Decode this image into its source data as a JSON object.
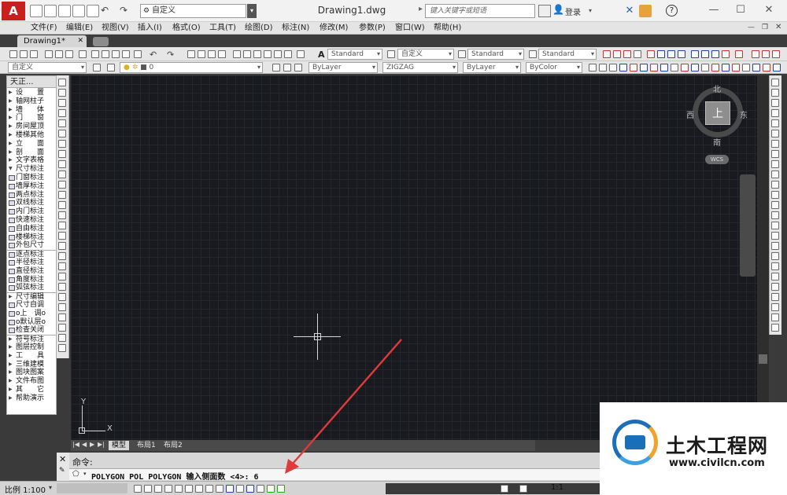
{
  "app": {
    "logo_letter": "A",
    "workspace": "自定义",
    "document_title": "Drawing1.dwg",
    "search_placeholder": "键入关键字或短语",
    "login_label": "登录",
    "help_symbol": "?"
  },
  "menu": {
    "items": [
      "文件(F)",
      "编辑(E)",
      "视图(V)",
      "插入(I)",
      "格式(O)",
      "工具(T)",
      "绘图(D)",
      "标注(N)",
      "修改(M)",
      "参数(P)",
      "窗口(W)",
      "帮助(H)"
    ]
  },
  "tabs": {
    "document_tab": "Drawing1*"
  },
  "toolbar": {
    "text_style": "Standard",
    "dim_style": "自定义",
    "table_style": "Standard",
    "multileader_style": "Standard",
    "workspace_combo": "自定义",
    "layer_value": "0",
    "color": "ByLayer",
    "linetype": "ZIGZAG",
    "lineweight": "ByLayer",
    "plotstyle": "ByColor"
  },
  "left_panel": {
    "title": "天正...",
    "items": [
      {
        "label": "设　　置",
        "kind": "menu"
      },
      {
        "label": "轴网柱子",
        "kind": "menu"
      },
      {
        "label": "墙　　体",
        "kind": "menu"
      },
      {
        "label": "门　　窗",
        "kind": "menu"
      },
      {
        "label": "房间屋顶",
        "kind": "menu"
      },
      {
        "label": "楼梯其他",
        "kind": "menu"
      },
      {
        "label": "立　　面",
        "kind": "menu"
      },
      {
        "label": "剖　　面",
        "kind": "menu"
      },
      {
        "label": "文字表格",
        "kind": "menu"
      },
      {
        "label": "尺寸标注",
        "kind": "open"
      },
      {
        "label": "门窗标注",
        "kind": "tool"
      },
      {
        "label": "墙厚标注",
        "kind": "tool"
      },
      {
        "label": "两点标注",
        "kind": "tool"
      },
      {
        "label": "双线标注",
        "kind": "tool"
      },
      {
        "label": "内门标注",
        "kind": "tool"
      },
      {
        "label": "快速标注",
        "kind": "tool"
      },
      {
        "label": "自由标注",
        "kind": "tool"
      },
      {
        "label": "楼梯标注",
        "kind": "tool"
      },
      {
        "label": "外包尺寸",
        "kind": "tool"
      },
      {
        "label": "逐点标注",
        "kind": "tool",
        "sep": true
      },
      {
        "label": "半径标注",
        "kind": "tool"
      },
      {
        "label": "直径标注",
        "kind": "tool"
      },
      {
        "label": "角度标注",
        "kind": "tool"
      },
      {
        "label": "弧弦标注",
        "kind": "tool"
      },
      {
        "label": "尺寸编辑",
        "kind": "menu",
        "sep": true
      },
      {
        "label": "尺寸自调",
        "kind": "tool"
      },
      {
        "label": "o上　调o",
        "kind": "tool"
      },
      {
        "label": "o默认层o",
        "kind": "tool"
      },
      {
        "label": "检查关闭",
        "kind": "tool"
      },
      {
        "label": "符号标注",
        "kind": "menu",
        "sep": true
      },
      {
        "label": "图层控制",
        "kind": "menu"
      },
      {
        "label": "工　　具",
        "kind": "menu"
      },
      {
        "label": "三维建模",
        "kind": "menu"
      },
      {
        "label": "图块图案",
        "kind": "menu"
      },
      {
        "label": "文件布图",
        "kind": "menu"
      },
      {
        "label": "其　　它",
        "kind": "menu"
      },
      {
        "label": "帮助演示",
        "kind": "menu"
      }
    ]
  },
  "viewcube": {
    "north": "北",
    "south": "南",
    "east": "东",
    "west": "西",
    "face": "上",
    "wcs": "WCS"
  },
  "ucs": {
    "x_label": "X",
    "y_label": "Y"
  },
  "layout_tabs": [
    "模型",
    "布局1",
    "布局2"
  ],
  "command": {
    "history": "命令:",
    "input": "POLYGON POL POLYGON 输入侧面数 <4>: 6"
  },
  "status": {
    "scale": "比例 1:100",
    "annotation_scale": "1:1"
  },
  "watermark": {
    "brand": "土木工程网",
    "url": "www.civilcn.com"
  },
  "colors": {
    "canvas_bg": "#181a1f",
    "grid": "#23262b",
    "annotation_arrow": "#e03a3a",
    "logo_red": "#c8201c"
  }
}
